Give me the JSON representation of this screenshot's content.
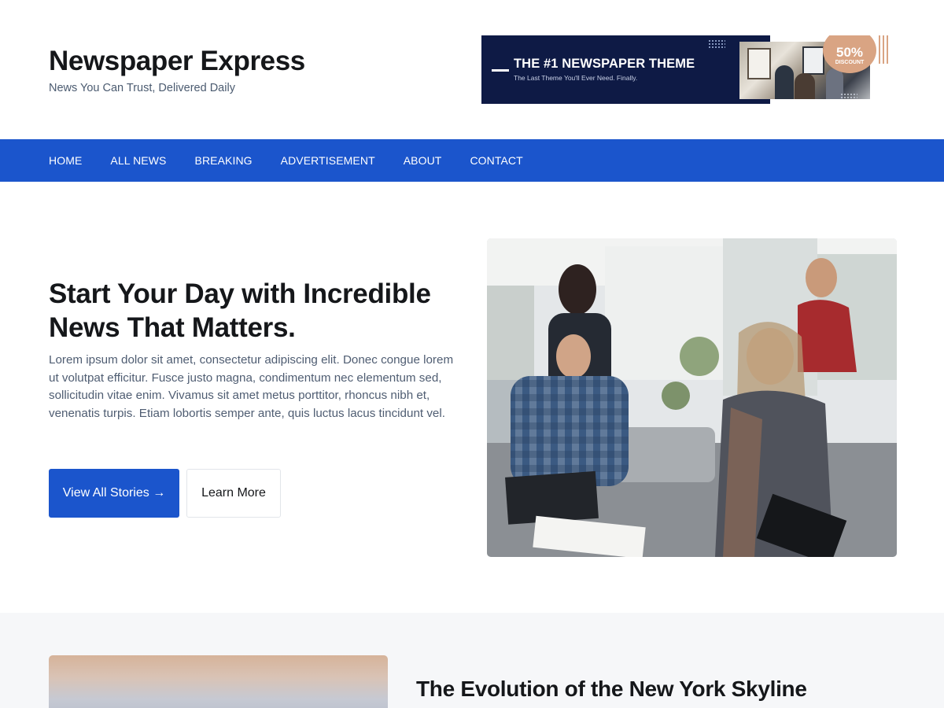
{
  "site": {
    "title": "Newspaper Express",
    "tagline": "News You Can Trust, Delivered Daily"
  },
  "ad": {
    "headline": "THE #1 NEWSPAPER THEME",
    "subline": "The Last Theme You'll Ever Need. Finally.",
    "badge_percent": "50%",
    "badge_label": "DISCOUNT"
  },
  "nav": {
    "items": [
      {
        "label": "HOME"
      },
      {
        "label": "ALL NEWS"
      },
      {
        "label": "BREAKING"
      },
      {
        "label": "ADVERTISEMENT"
      },
      {
        "label": "ABOUT"
      },
      {
        "label": "CONTACT"
      }
    ]
  },
  "hero": {
    "heading": "Start Your Day with Incredible News That Matters.",
    "body": "Lorem ipsum dolor sit amet, consectetur adipiscing elit. Donec congue lorem ut volutpat efficitur. Fusce justo magna, condimentum nec elementum sed, sollicitudin vitae enim. Vivamus sit amet metus porttitor, rhoncus nibh et, venenatis turpis. Etiam lobortis semper ante, quis luctus lacus tincidunt vel.",
    "primary_button": "View All Stories →",
    "secondary_button": "Learn More"
  },
  "featured_story": {
    "title": "The Evolution of the New York Skyline"
  },
  "colors": {
    "brand_blue": "#1b55cc",
    "ad_navy": "#0e1a45",
    "ad_accent": "#d9a483",
    "section_bg": "#f6f7f9"
  }
}
